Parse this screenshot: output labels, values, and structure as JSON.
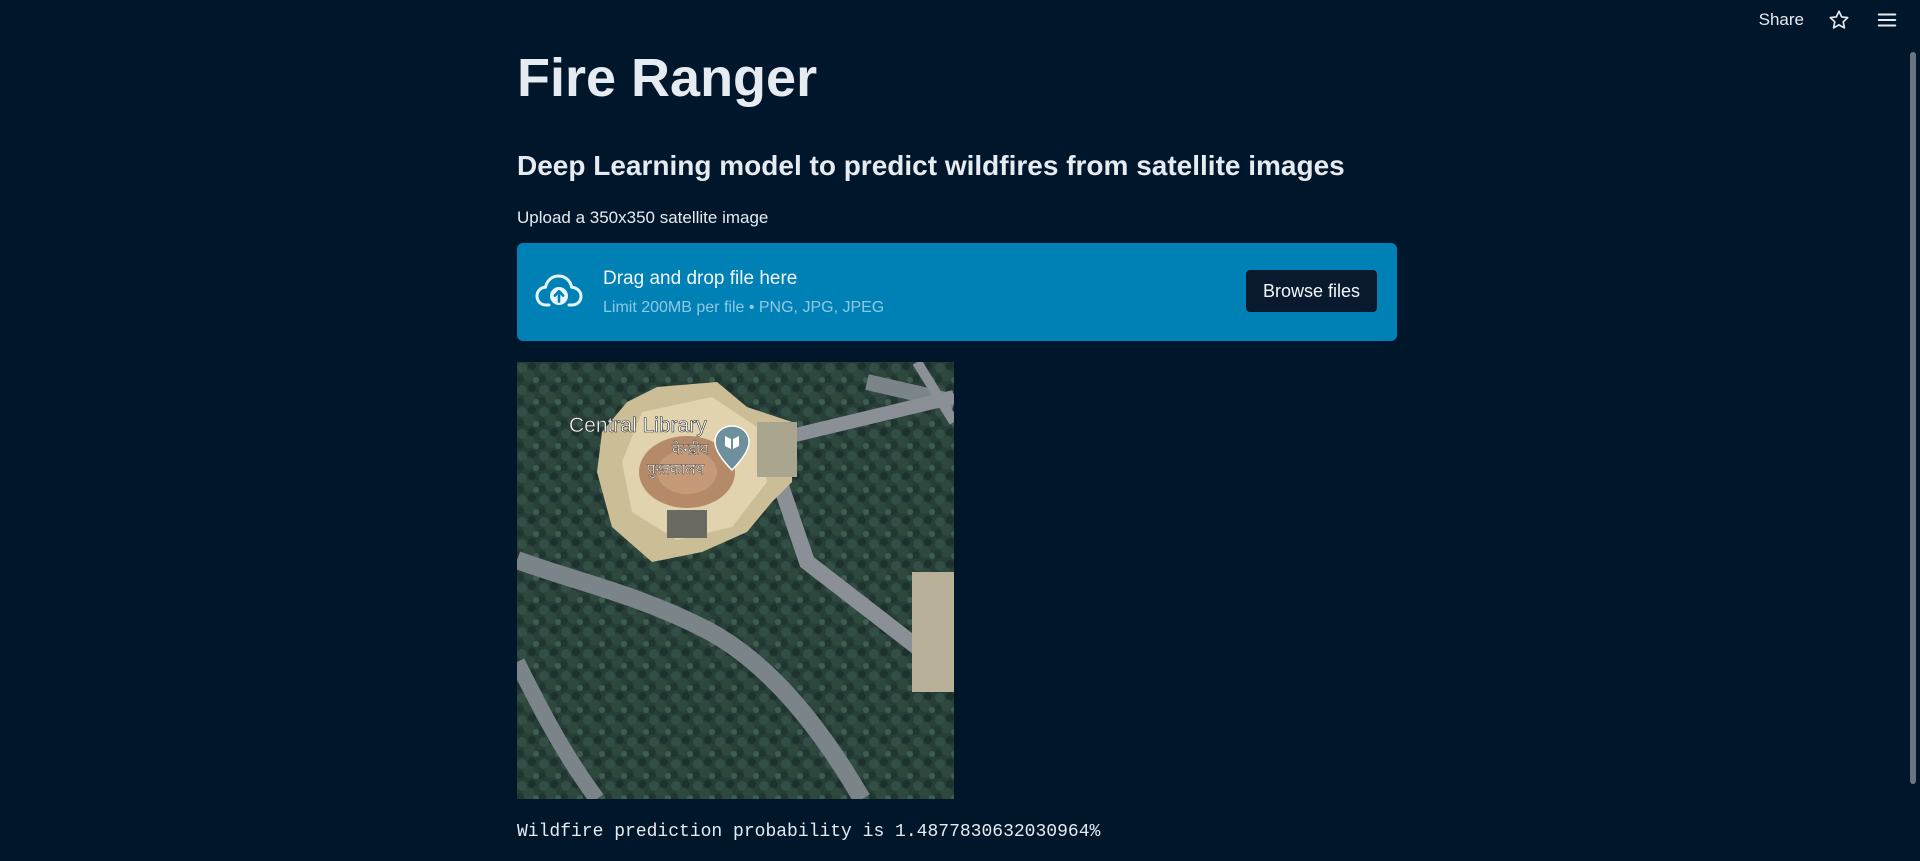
{
  "header": {
    "share_label": "Share",
    "icons": [
      "star-icon",
      "hamburger-menu-icon"
    ]
  },
  "main": {
    "title": "Fire Ranger",
    "subtitle": "Deep Learning model to predict wildfires from satellite images",
    "uploader": {
      "label": "Upload a 350x350 satellite image",
      "dropzone_title": "Drag and drop file here",
      "dropzone_limit": "Limit 200MB per file • PNG, JPG, JPEG",
      "browse_label": "Browse files",
      "icon": "cloud-upload-icon"
    },
    "image": {
      "map_label_en": "Central Library",
      "map_label_hi_1": "केन्द्रीय",
      "map_label_hi_2": "पुस्तकालय",
      "marker_icon": "book-marker-icon"
    },
    "prediction_text": "Wildfire prediction probability is 1.4877830632030964%"
  },
  "colors": {
    "background": "#00172b",
    "dropzone": "#0081b6",
    "button": "#0a1a2e",
    "text": "#e6eaf1"
  }
}
